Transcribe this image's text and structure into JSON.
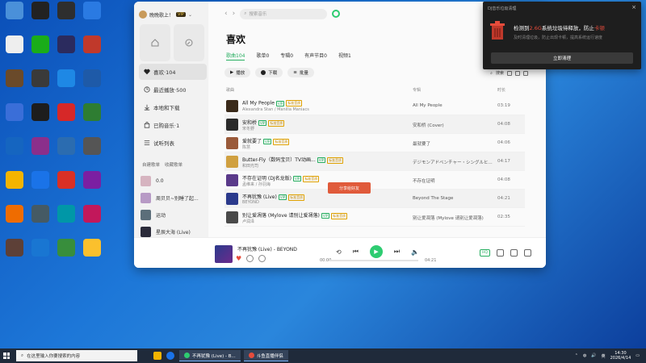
{
  "desktop": {
    "icons": [
      {
        "label": "",
        "color": "#4a90d9"
      },
      {
        "label": "",
        "color": "#222222"
      },
      {
        "label": "",
        "color": "#2e2e2e"
      },
      {
        "label": "",
        "color": "#2a7ae2"
      },
      {
        "label": "",
        "color": "#eeeeee"
      },
      {
        "label": "",
        "color": "#1aad19"
      },
      {
        "label": "",
        "color": "#2b2b5e"
      },
      {
        "label": "",
        "color": "#c0392b"
      },
      {
        "label": "",
        "color": "#6a4a2a"
      },
      {
        "label": "",
        "color": "#3a3a3a"
      },
      {
        "label": "",
        "color": "#1e88e5"
      },
      {
        "label": "",
        "color": "#1e5aa8"
      },
      {
        "label": "",
        "color": "#3a6ed8"
      },
      {
        "label": "",
        "color": "#1d1d1d"
      },
      {
        "label": "",
        "color": "#d62828"
      },
      {
        "label": "",
        "color": "#2e7d32"
      },
      {
        "label": "",
        "color": "#1565c0"
      },
      {
        "label": "",
        "color": "#8b2f8b"
      },
      {
        "label": "",
        "color": "#2b6cb0"
      },
      {
        "label": "",
        "color": "#555555"
      },
      {
        "label": "",
        "color": "#f4b400"
      },
      {
        "label": "",
        "color": "#1a73e8"
      },
      {
        "label": "",
        "color": "#d93025"
      },
      {
        "label": "",
        "color": "#7b1fa2"
      },
      {
        "label": "",
        "color": "#ef6c00"
      },
      {
        "label": "",
        "color": "#455a64"
      },
      {
        "label": "",
        "color": "#0097a7"
      },
      {
        "label": "",
        "color": "#c2185b"
      },
      {
        "label": "",
        "color": "#5d4037"
      },
      {
        "label": "",
        "color": "#1976d2"
      },
      {
        "label": "",
        "color": "#388e3c"
      },
      {
        "label": "",
        "color": "#fbc02d"
      }
    ]
  },
  "app": {
    "user": {
      "name": "晚晚歌上！",
      "vip": "VIP"
    },
    "nav": [
      {
        "label": "喜欢·104",
        "icon": "heart-icon",
        "active": true
      },
      {
        "label": "最近播放·500",
        "icon": "clock-icon",
        "active": false
      },
      {
        "label": "本地和下载",
        "icon": "download-icon",
        "active": false
      },
      {
        "label": "已购音乐·1",
        "icon": "bag-icon",
        "active": false
      },
      {
        "label": "试听列表",
        "icon": "list-icon",
        "active": false
      }
    ],
    "section": {
      "own": "自建歌单",
      "fav": "收藏歌单"
    },
    "playlists": [
      {
        "name": "0.0",
        "color": "#d6b4c0"
      },
      {
        "name": "周贝贝~别睡了起...",
        "color": "#b79ac5"
      },
      {
        "name": "运动",
        "color": "#5b6e7a"
      },
      {
        "name": "星辰大海 (Live)",
        "color": "#2b2b3a"
      }
    ],
    "search_placeholder": "搜索音乐",
    "page_title": "喜欢",
    "tabs": [
      {
        "label": "歌曲104",
        "active": true
      },
      {
        "label": "歌单0",
        "active": false
      },
      {
        "label": "专辑0",
        "active": false
      },
      {
        "label": "有声节目0",
        "active": false
      },
      {
        "label": "视频1",
        "active": false
      }
    ],
    "actions": {
      "play": "播放",
      "download": "下载",
      "batch": "批量"
    },
    "search_small": "搜索",
    "headers": {
      "song": "歌曲",
      "album": "专辑",
      "dur": "时长"
    },
    "songs": [
      {
        "title": "All My People",
        "artist": "Alexandra Stan / Manilla Maniacs",
        "album": "All My People",
        "dur": "03:19",
        "tags": [
          "VIP",
          "标准音质"
        ],
        "color": "#3a2a1a"
      },
      {
        "title": "安和桥",
        "artist": "宋冬野",
        "album": "安和桥 (Cover)",
        "dur": "04:08",
        "tags": [
          "VIP",
          "标准音质"
        ],
        "color": "#2a2a2a"
      },
      {
        "title": "爱就要了",
        "artist": "陈慧",
        "album": "最就要了",
        "dur": "04:06",
        "tags": [
          "VIP",
          "标准音质"
        ],
        "color": "#9a5a3a"
      },
      {
        "title": "Butter-Fly（数码宝贝）TV动画...",
        "artist": "和田光司",
        "album": "デジモンアドベンチャー・シングルヒ...",
        "dur": "04:17",
        "tags": [
          "VIP",
          "标准音质"
        ],
        "color": "#d0a040"
      },
      {
        "title": "不存在证明 (DJ名龙版)",
        "artist": "孟维来 / 孙羽海",
        "album": "不存在证明",
        "dur": "04:08",
        "tags": [
          "VIP",
          "标准音质"
        ],
        "color": "#5a3a8a"
      },
      {
        "title": "不再犹豫 (Live)",
        "artist": "BEYOND",
        "album": "Beyond The Stage",
        "dur": "04:21",
        "tags": [
          "VIP",
          "标准音质"
        ],
        "color": "#2b3a8c"
      },
      {
        "title": "别让爱凋落 (Mylove 请别让爱凋落)",
        "artist": "卢润泽",
        "album": "别让爱凋落 (Mylove 请别让爱凋落)",
        "dur": "02:35",
        "tags": [
          "VIP",
          "标准音质"
        ],
        "color": "#4a4a4a"
      }
    ],
    "toast": "分享给好友",
    "player": {
      "title": "不再犹豫 (Live) - BEYOND",
      "current": "00:00",
      "total": "04:21",
      "progress": 0.0,
      "quality": "HQ"
    }
  },
  "notification": {
    "head": "DJ音乐垃圾清理",
    "msg_pre": "检测到",
    "msg_size": "2.6G",
    "msg_mid": "系统垃圾待释放，防止",
    "msg_warn": "卡顿",
    "sub": "及时清理垃圾，防止出现卡顿，提高系统运行速度",
    "button": "立即清理"
  },
  "taskbar": {
    "search": "在这里输入你要搜索的内容",
    "windows": [
      {
        "label": "不再犹豫 (Live) - B...",
        "color": "#2ecc71"
      },
      {
        "label": "斗鱼直播伴侣",
        "color": "#e74c3c"
      }
    ],
    "ime": "英",
    "time": "14:30",
    "date": "2026/4/14"
  }
}
